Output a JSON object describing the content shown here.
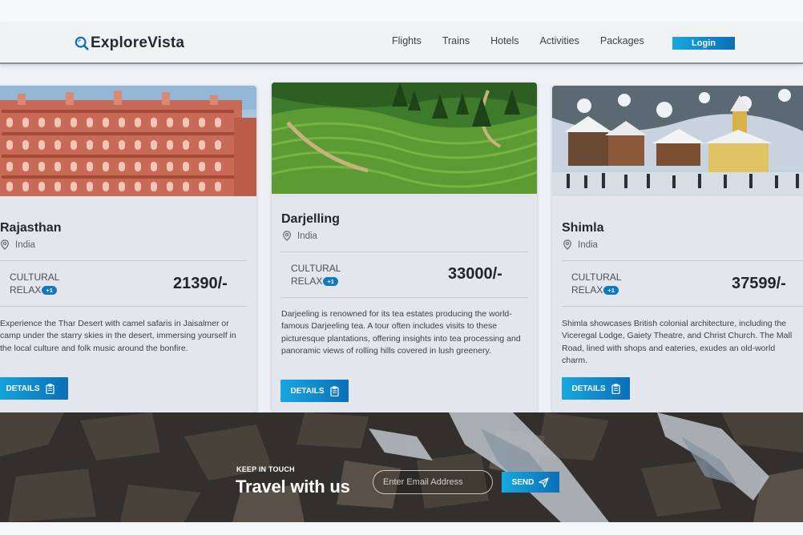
{
  "brand": {
    "name": "ExploreVista",
    "logo_icon": "search-globe-icon"
  },
  "nav": {
    "links": [
      "Flights",
      "Trains",
      "Hotels",
      "Activities",
      "Packages"
    ],
    "login_label": "Login"
  },
  "cards": [
    {
      "city": "Rajasthan",
      "country": "India",
      "tag1": "CULTURAL",
      "tag2": "RELAX",
      "extra_badge": "+1",
      "price": "21390/-",
      "description": "Experience the Thar Desert with camel safaris in Jaisalmer or camp under the starry skies in the desert, immersing yourself in the local culture and folk music around the bonfire.",
      "button": "DETAILS"
    },
    {
      "city": "Darjelling",
      "country": "India",
      "tag1": "CULTURAL",
      "tag2": "RELAX",
      "extra_badge": "+1",
      "price": "33000/-",
      "description": "Darjeeling is renowned for its tea estates producing the world-famous Darjeeling tea. A tour often includes visits to these picturesque plantations, offering insights into tea processing and panoramic views of rolling hills covered in lush greenery.",
      "button": "DETAILS"
    },
    {
      "city": "Shimla",
      "country": "India",
      "tag1": "CULTURAL",
      "tag2": "RELAX",
      "extra_badge": "+1",
      "price": "37599/-",
      "description": "Shimla showcases British colonial architecture, including the Viceregal Lodge, Gaiety Theatre, and Christ Church. The Mall Road, lined with shops and eateries, exudes an old-world charm.",
      "button": "DETAILS"
    }
  ],
  "newsletter": {
    "kicker": "KEEP IN TOUCH",
    "heading": "Travel with us",
    "email_placeholder": "Enter Email Address",
    "send_label": "SEND"
  },
  "colors": {
    "accent_start": "#17a8df",
    "accent_end": "#0b6fb8",
    "badge": "#0f79c0"
  }
}
